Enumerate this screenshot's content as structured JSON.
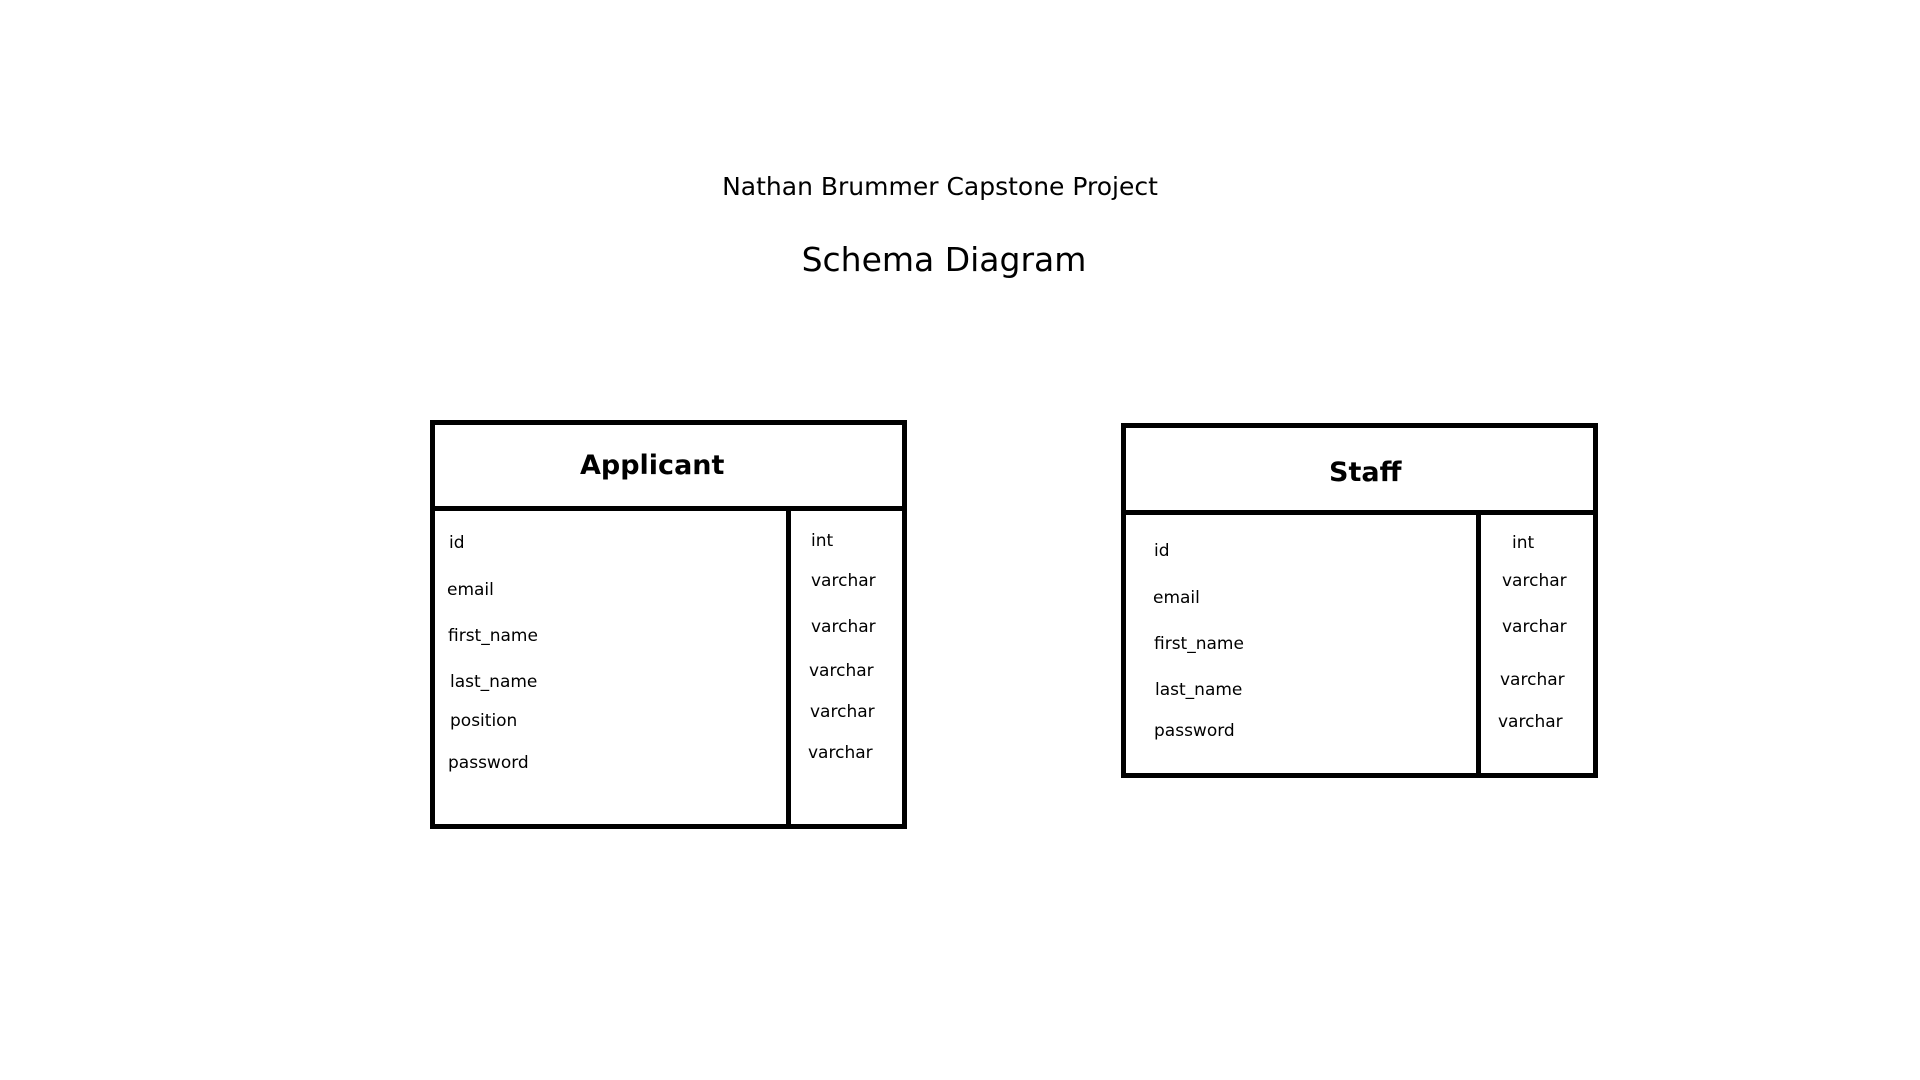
{
  "header": {
    "subtitle": "Nathan Brummer Capstone Project",
    "title": "Schema Diagram"
  },
  "tables": {
    "applicant": {
      "name": "Applicant",
      "fields": [
        {
          "name": "id",
          "type": "int"
        },
        {
          "name": "email",
          "type": "varchar"
        },
        {
          "name": "first_name",
          "type": "varchar"
        },
        {
          "name": "last_name",
          "type": "varchar"
        },
        {
          "name": "position",
          "type": "varchar"
        },
        {
          "name": "password",
          "type": "varchar"
        }
      ]
    },
    "staff": {
      "name": "Staff",
      "fields": [
        {
          "name": "id",
          "type": "int"
        },
        {
          "name": "email",
          "type": "varchar"
        },
        {
          "name": "first_name",
          "type": "varchar"
        },
        {
          "name": "last_name",
          "type": "varchar"
        },
        {
          "name": "password",
          "type": "varchar"
        }
      ]
    }
  }
}
